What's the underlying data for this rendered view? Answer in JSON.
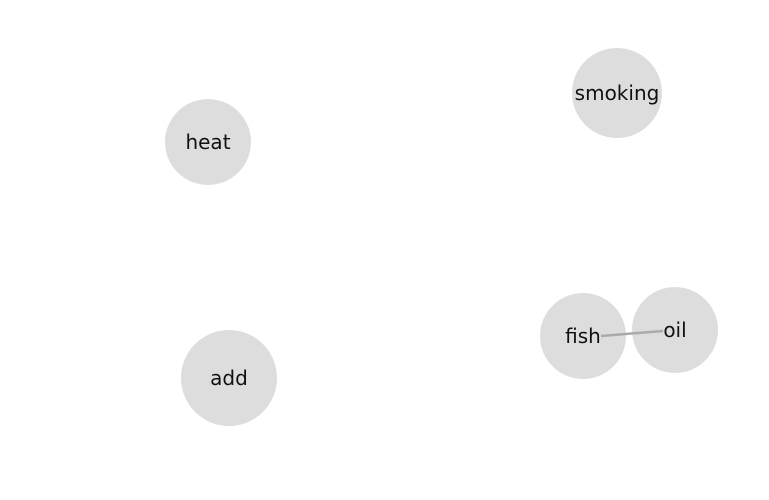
{
  "diagram": {
    "nodes": [
      {
        "id": "heat",
        "label": "heat"
      },
      {
        "id": "smoking",
        "label": "smoking"
      },
      {
        "id": "add",
        "label": "add"
      },
      {
        "id": "fish",
        "label": "fish"
      },
      {
        "id": "oil",
        "label": "oil"
      }
    ],
    "edges": [
      {
        "source": "fish",
        "target": "oil"
      }
    ],
    "colors": {
      "node_fill": "#dddddd",
      "edge_stroke": "#aaaaaa",
      "label": "#111111",
      "background": "#ffffff"
    }
  }
}
